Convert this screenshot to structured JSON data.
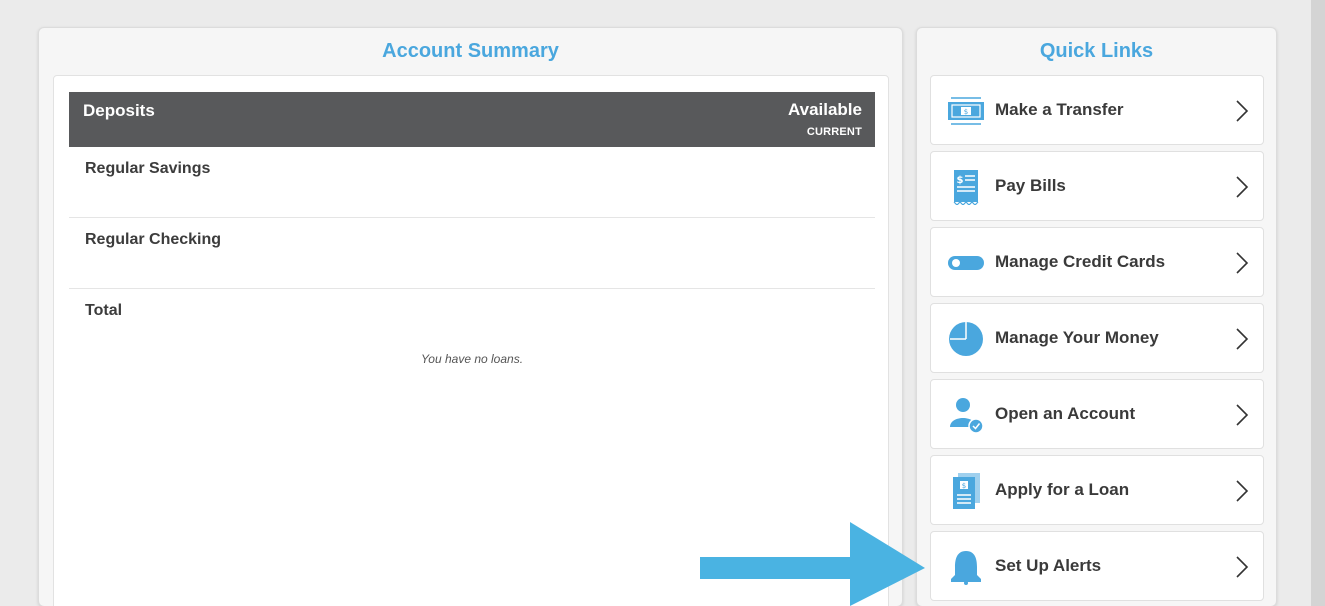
{
  "account_summary": {
    "title": "Account Summary",
    "deposits_header": "Deposits",
    "available_label": "Available",
    "current_label": "CURRENT",
    "accounts": [
      {
        "name": "Regular Savings"
      },
      {
        "name": "Regular Checking"
      },
      {
        "name": "Total"
      }
    ],
    "no_loans_text": "You have no loans."
  },
  "quick_links": {
    "title": "Quick Links",
    "items": [
      {
        "label": "Make a Transfer",
        "icon": "transfer-icon"
      },
      {
        "label": "Pay Bills",
        "icon": "bill-icon"
      },
      {
        "label": "Manage Credit Cards",
        "icon": "credit-card-toggle-icon"
      },
      {
        "label": "Manage Your Money",
        "icon": "pie-chart-icon"
      },
      {
        "label": "Open an Account",
        "icon": "user-check-icon"
      },
      {
        "label": "Apply for a Loan",
        "icon": "loan-document-icon"
      },
      {
        "label": "Set Up Alerts",
        "icon": "bell-icon"
      }
    ]
  },
  "colors": {
    "accent": "#4aa7de",
    "header_bg": "#58595b",
    "arrow": "#4ab3e2"
  }
}
